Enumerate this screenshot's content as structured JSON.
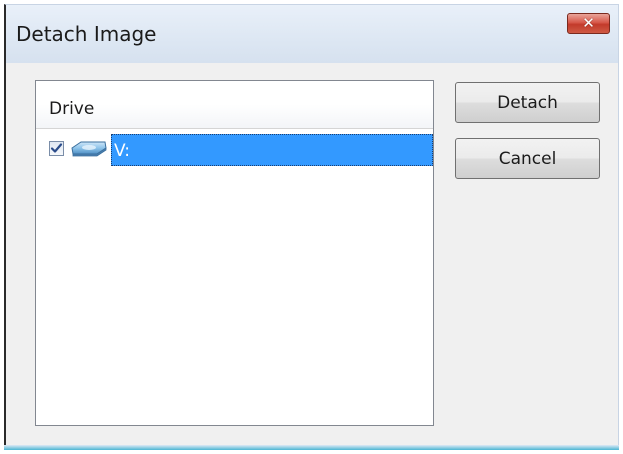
{
  "window": {
    "title": "Detach Image",
    "close_label": "✕"
  },
  "list": {
    "column_header": "Drive",
    "items": [
      {
        "label": "V:",
        "checked": true,
        "selected": true,
        "icon": "drive-icon"
      }
    ]
  },
  "buttons": {
    "detach_label": "Detach",
    "cancel_label": "Cancel"
  },
  "colors": {
    "selection": "#3399ff",
    "close_button": "#c23a2b",
    "dialog_background": "#f0f0f0"
  }
}
